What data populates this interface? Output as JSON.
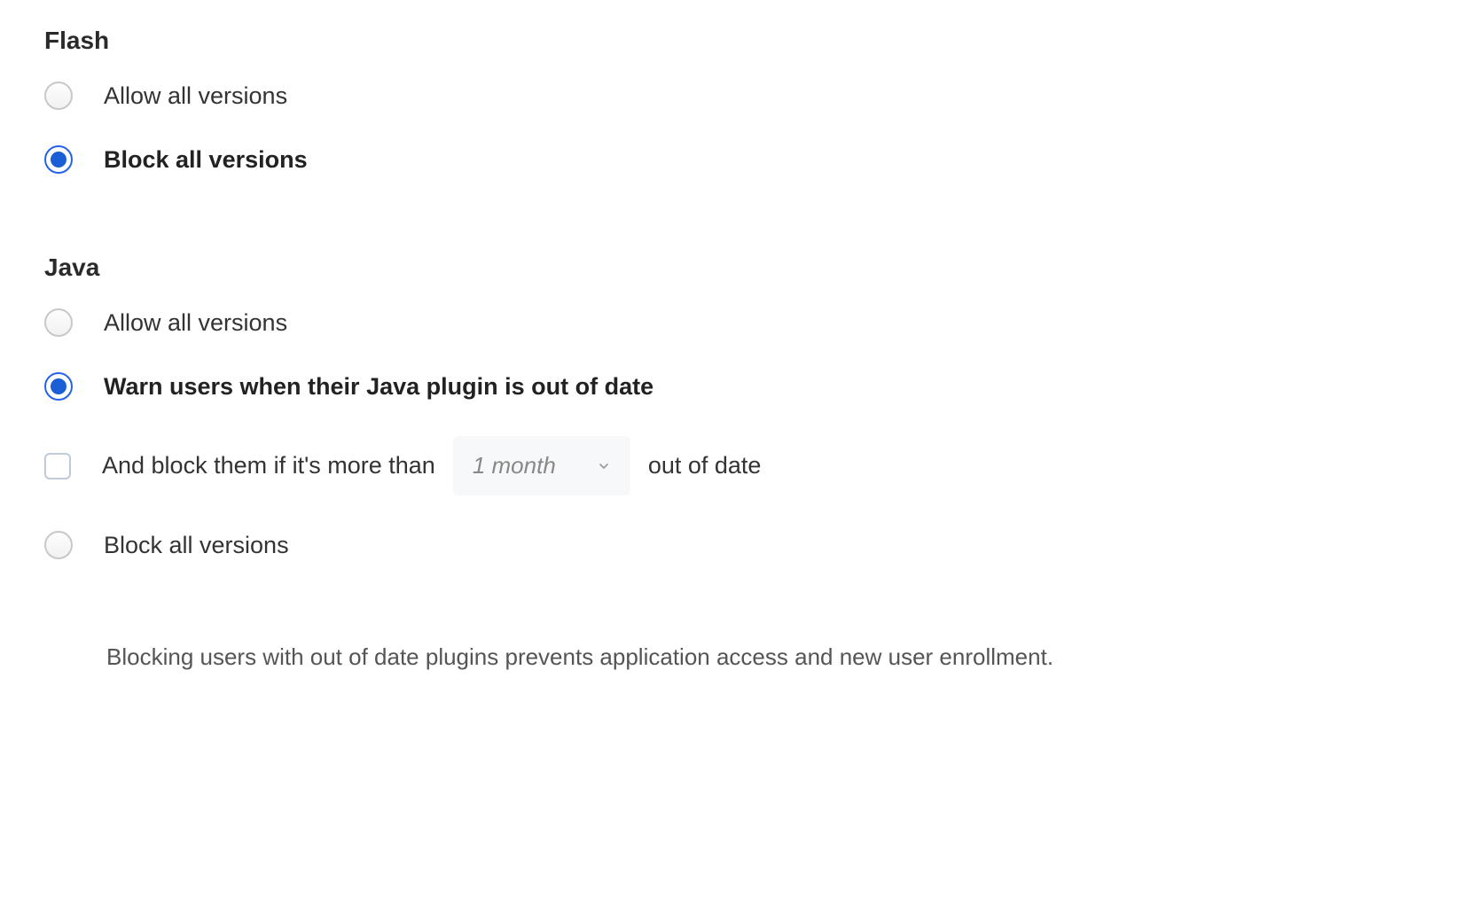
{
  "flash": {
    "heading": "Flash",
    "options": {
      "allow": "Allow all versions",
      "block": "Block all versions"
    }
  },
  "java": {
    "heading": "Java",
    "options": {
      "allow": "Allow all versions",
      "warn": "Warn users when their Java plugin is out of date",
      "block": "Block all versions"
    },
    "block_sub": {
      "prefix": "And block them if it's more than",
      "dropdown_value": "1 month",
      "suffix": "out of date"
    }
  },
  "footnote": "Blocking users with out of date plugins prevents application access and new user enrollment."
}
